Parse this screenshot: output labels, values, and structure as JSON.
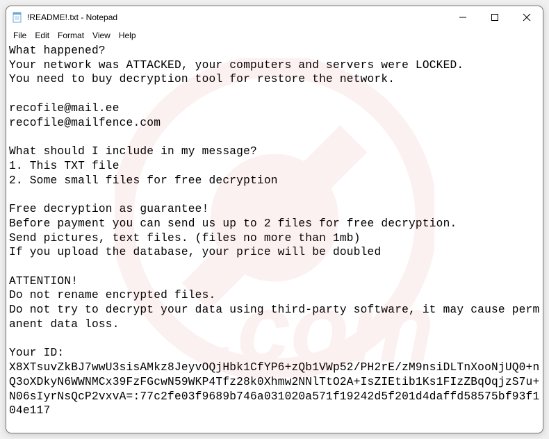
{
  "titlebar": {
    "title": "!README!.txt - Notepad"
  },
  "menubar": {
    "items": [
      "File",
      "Edit",
      "Format",
      "View",
      "Help"
    ]
  },
  "content": {
    "text": "What happened?\nYour network was ATTACKED, your computers and servers were LOCKED.\nYou need to buy decryption tool for restore the network.\n\nrecofile@mail.ee\nrecofile@mailfence.com\n\nWhat should I include in my message?\n1. This TXT file\n2. Some small files for free decryption\n\nFree decryption as guarantee!\nBefore payment you can send us up to 2 files for free decryption.\nSend pictures, text files. (files no more than 1mb)\nIf you upload the database, your price will be doubled\n\nATTENTION!\nDo not rename encrypted files.\nDo not try to decrypt your data using third-party software, it may cause permanent data loss.\n\nYour ID:\nX8XTsuvZkBJ7wwU3sisAMkz8JeyvOQjHbk1CfYP6+zQb1VWp52/PH2rE/zM9nsiDLTnXooNjUQ0+nQ3oXDkyN6WWNMCx39FzFGcwN59WKP4Tfz28k0Xhmw2NNlTtO2A+IsZIEtib1Ks1FIzZBqOqjzS7u+N06sIyrNsQcP2vxvA=:77c2fe03f9689b746a031020a571f19242d5f201d4daffd58575bf93f104e117"
  }
}
